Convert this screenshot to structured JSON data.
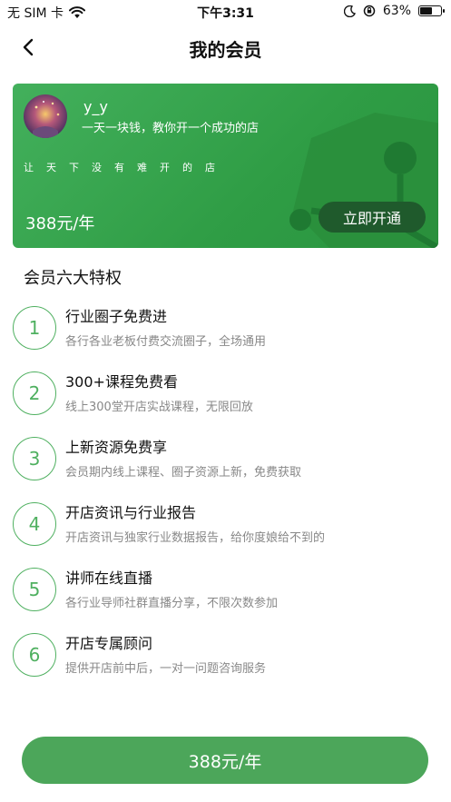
{
  "status_bar": {
    "carrier": "无 SIM 卡",
    "time": "下午3:31",
    "battery": "63%",
    "battery_level": 0.63,
    "icons": [
      "wifi-icon",
      "moon-icon",
      "orientation-lock-icon",
      "battery-icon"
    ]
  },
  "nav": {
    "title": "我的会员",
    "back_icon": "chevron-left-icon"
  },
  "card": {
    "username": "y_y",
    "slogan": "一天一块钱，教你开一个成功的店",
    "tagline": "让天下没有难开的店",
    "price": "388元/年",
    "open_button": "立即开通",
    "colors": {
      "card": "#34a24b",
      "button": "#1f5a2c"
    }
  },
  "section_title": "会员六大特权",
  "privileges": [
    {
      "num": "1",
      "title": "行业圈子免费进",
      "desc": "各行各业老板付费交流圈子，全场通用"
    },
    {
      "num": "2",
      "title": "300+课程免费看",
      "desc": "线上300堂开店实战课程，无限回放"
    },
    {
      "num": "3",
      "title": "上新资源免费享",
      "desc": "会员期内线上课程、圈子资源上新，免费获取"
    },
    {
      "num": "4",
      "title": "开店资讯与行业报告",
      "desc": "开店资讯与独家行业数据报告，给你度娘给不到的"
    },
    {
      "num": "5",
      "title": "讲师在线直播",
      "desc": "各行业导师社群直播分享，不限次数参加"
    },
    {
      "num": "6",
      "title": "开店专属顾问",
      "desc": "提供开店前中后，一对一问题咨询服务"
    }
  ],
  "bottom_button": "388元/年",
  "accent_color": "#4ca65a"
}
